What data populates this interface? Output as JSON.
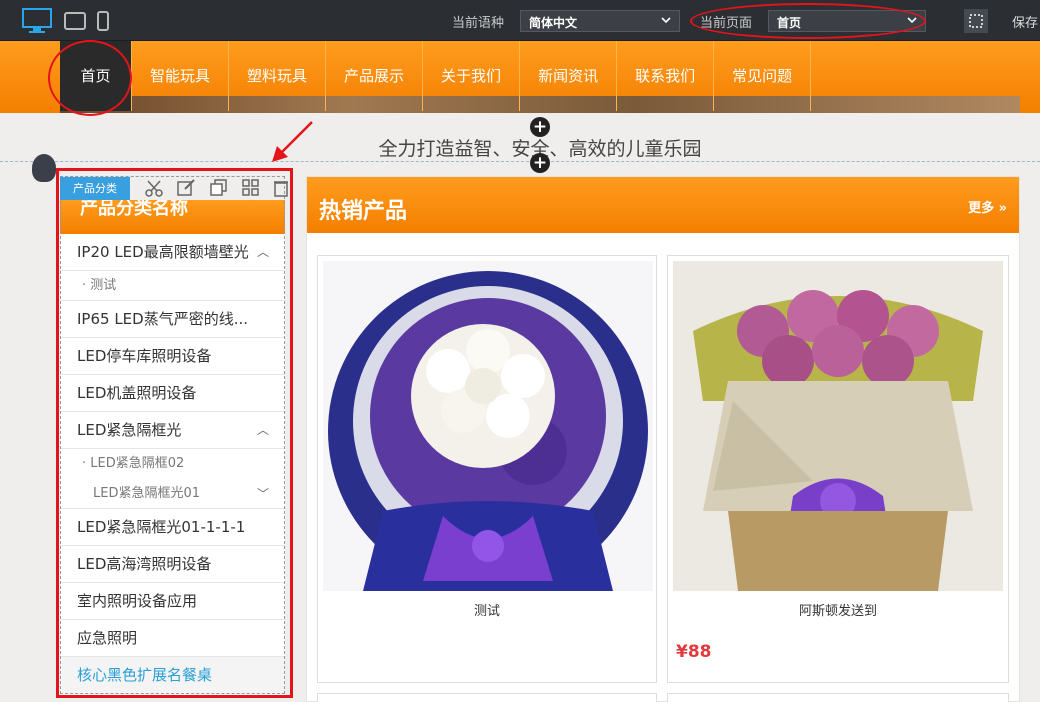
{
  "toolbar": {
    "language_label": "当前语种",
    "language_value": "简体中文",
    "page_label": "当前页面",
    "page_value": "首页",
    "save_label": "保存"
  },
  "nav": {
    "items": [
      "首页",
      "智能玩具",
      "塑料玩具",
      "产品展示",
      "关于我们",
      "新闻资讯",
      "联系我们",
      "常见问题"
    ]
  },
  "slogan": "全力打造益智、安全、高效的儿童乐园",
  "sidebar": {
    "module_tag": "产品分类",
    "title": "产品分类名称",
    "categories": [
      "IP20 LED最高限额墙壁光",
      "IP65 LED蒸气严密的线...",
      "LED停车库照明设备",
      "LED机盖照明设备",
      "LED紧急隔框光",
      "LED紧急隔框光01-1-1-1",
      "LED高海湾照明设备",
      "室内照明设备应用",
      "应急照明",
      "核心黑色扩展名餐桌"
    ],
    "subcategories": [
      "测试",
      "LED紧急隔框02",
      "LED紧急隔框光01"
    ]
  },
  "products_panel": {
    "title": "热销产品",
    "more_label": "更多 »",
    "products": [
      {
        "name": "测试",
        "price": ""
      },
      {
        "name": "阿斯顿发送到",
        "price": "¥88"
      }
    ]
  },
  "icons": [
    "desktop-icon",
    "tablet-icon",
    "mobile-icon",
    "select-frame-icon",
    "scissors-icon",
    "edit-icon",
    "copy-icon",
    "grid-icon",
    "delete-icon",
    "add-icon"
  ],
  "colors": {
    "accent": "#f47f00",
    "highlight": "#e4141b",
    "tag": "#3a9fdf",
    "price": "#e4393c"
  }
}
